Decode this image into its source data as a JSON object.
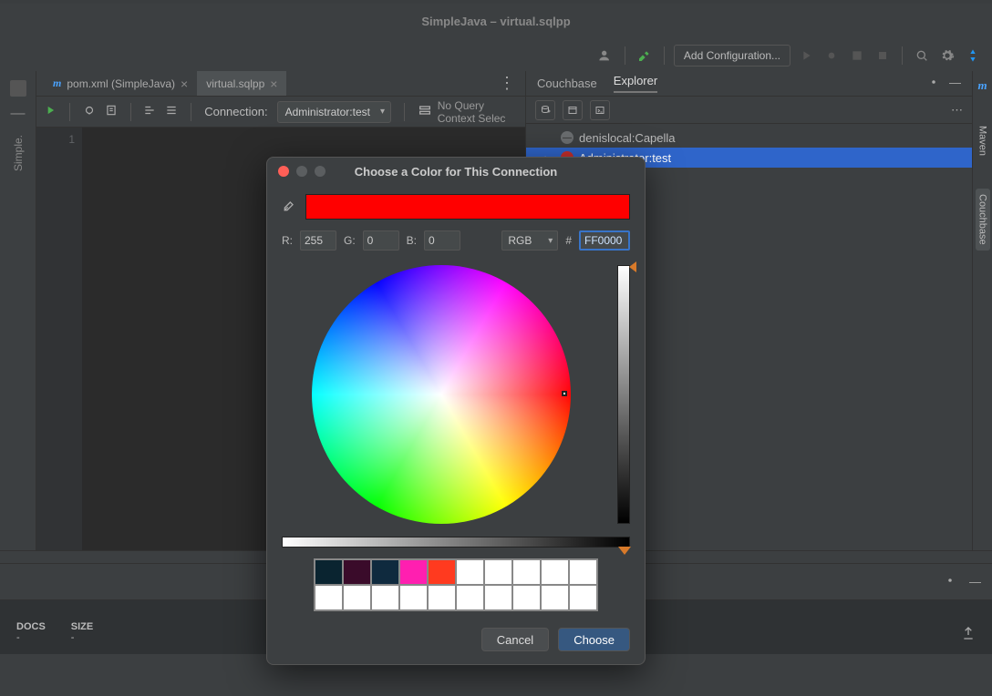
{
  "window_title": "SimpleJava – virtual.sqlpp",
  "toolbar": {
    "add_config": "Add Configuration..."
  },
  "left_gutter": {
    "label": "Simple."
  },
  "tabs": [
    {
      "label": "pom.xml (SimpleJava)",
      "active": false,
      "icon": "m"
    },
    {
      "label": "virtual.sqlpp",
      "active": true
    }
  ],
  "querybar": {
    "connection_label": "Connection:",
    "connection_value": "Administrator:test",
    "nocontext": "No Query Context Selec"
  },
  "editor": {
    "line1": "1"
  },
  "right_panel": {
    "tab1": "Couchbase",
    "tab2": "Explorer",
    "tree": [
      {
        "label": "denislocal:Capella",
        "sel": false,
        "color": "gray"
      },
      {
        "label": "Administrator:test",
        "sel": true,
        "color": "red"
      }
    ]
  },
  "right_gutter": {
    "m": "m",
    "maven": "Maven",
    "couchbase": "Couchbase"
  },
  "stats": {
    "docs_label": "DOCS",
    "docs_value": "-",
    "size_label": "SIZE",
    "size_value": "-"
  },
  "dialog": {
    "title": "Choose a Color for This Connection",
    "r_label": "R:",
    "g_label": "G:",
    "b_label": "B:",
    "r": "255",
    "g": "0",
    "b": "0",
    "mode": "RGB",
    "hash": "#",
    "hex": "FF0000",
    "cancel": "Cancel",
    "choose": "Choose"
  }
}
